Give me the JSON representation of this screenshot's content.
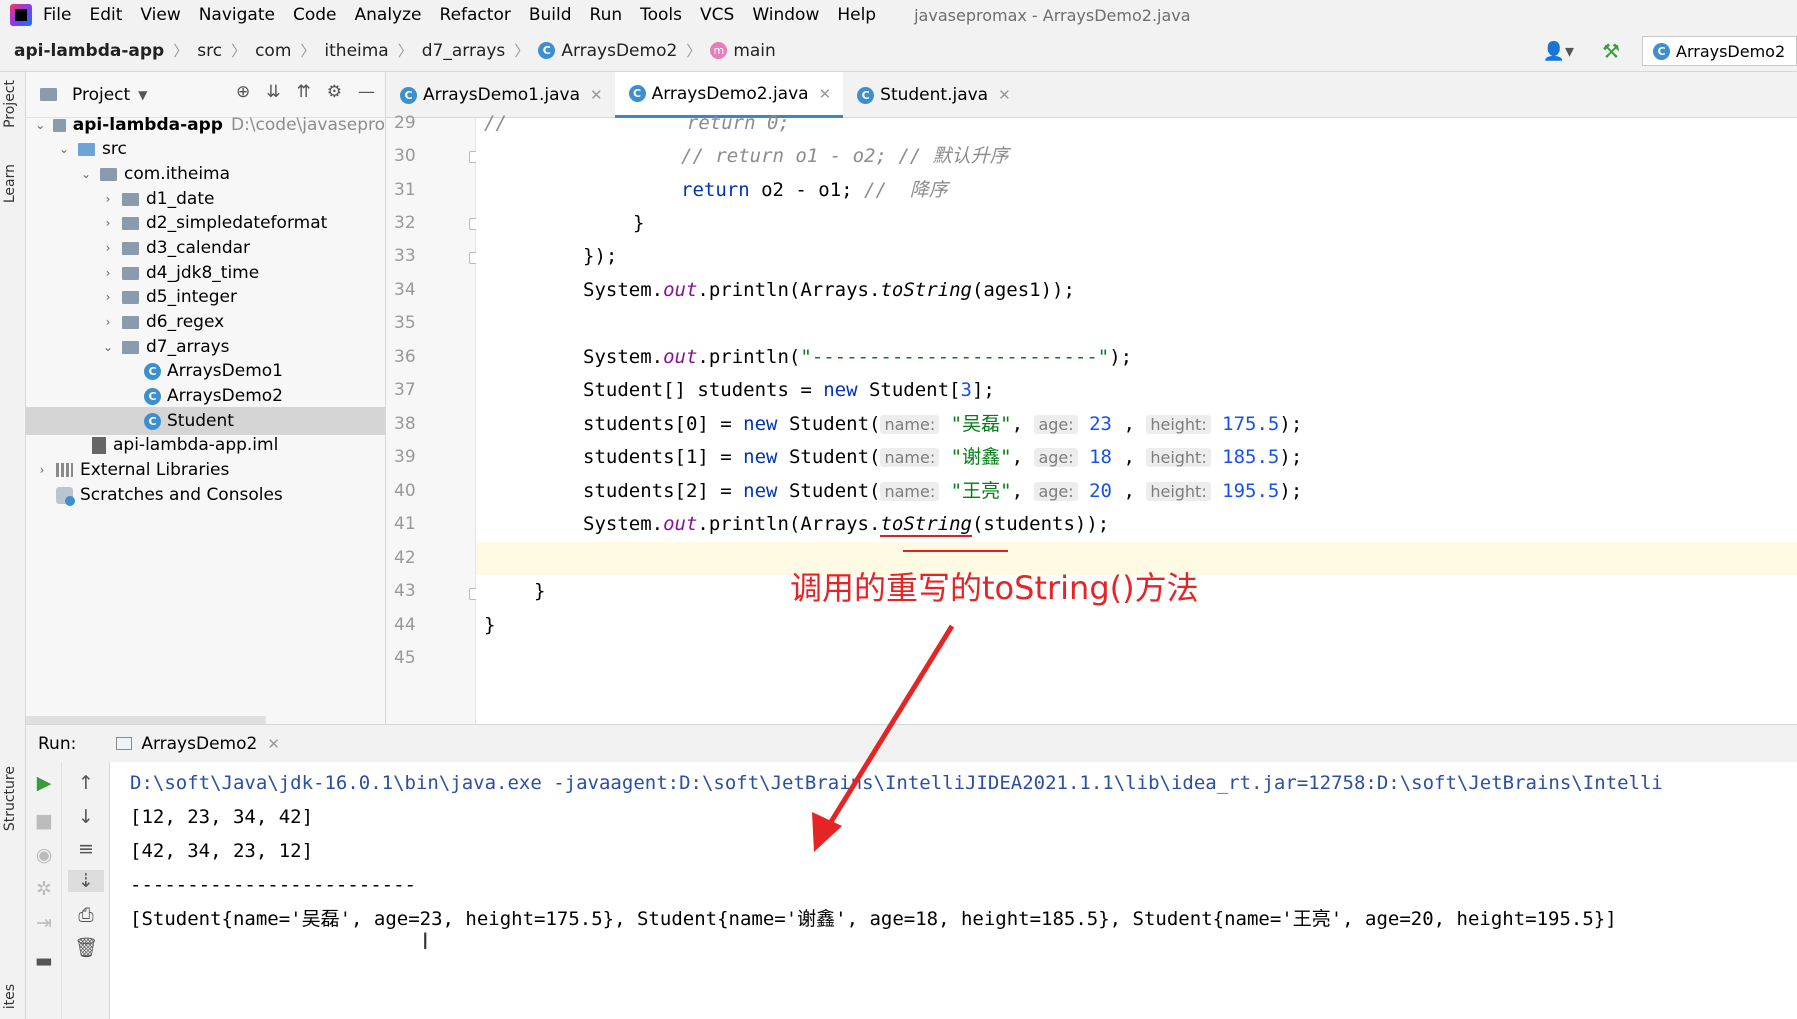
{
  "menubar": {
    "items": [
      "File",
      "Edit",
      "View",
      "Navigate",
      "Code",
      "Analyze",
      "Refactor",
      "Build",
      "Run",
      "Tools",
      "VCS",
      "Window",
      "Help"
    ],
    "window_title": "javasepromax - ArraysDemo2.java"
  },
  "navbar": {
    "breadcrumbs": [
      "api-lambda-app",
      "src",
      "com",
      "itheima",
      "d7_arrays",
      "ArraysDemo2",
      "main"
    ],
    "run_config": "ArraysDemo2"
  },
  "left_strip": {
    "project_tab": "Project",
    "learn_tab": "Learn",
    "structure_tab": "Structure",
    "bottom_tab": "ites"
  },
  "project_panel": {
    "title": "Project",
    "tree": [
      {
        "label": "api-lambda-app",
        "extra": "D:\\code\\javasepro"
      },
      {
        "label": "src"
      },
      {
        "label": "com.itheima"
      },
      {
        "label": "d1_date"
      },
      {
        "label": "d2_simpledateformat"
      },
      {
        "label": "d3_calendar"
      },
      {
        "label": "d4_jdk8_time"
      },
      {
        "label": "d5_integer"
      },
      {
        "label": "d6_regex"
      },
      {
        "label": "d7_arrays"
      },
      {
        "label": "ArraysDemo1"
      },
      {
        "label": "ArraysDemo2"
      },
      {
        "label": "Student"
      },
      {
        "label": "api-lambda-app.iml"
      },
      {
        "label": "External Libraries"
      },
      {
        "label": "Scratches and Consoles"
      }
    ]
  },
  "editor": {
    "tabs": [
      "ArraysDemo1.java",
      "ArraysDemo2.java",
      "Student.java"
    ],
    "line_numbers": [
      "29",
      "30",
      "31",
      "32",
      "33",
      "34",
      "35",
      "36",
      "37",
      "38",
      "39",
      "40",
      "41",
      "42",
      "43",
      "44",
      "45"
    ],
    "code": {
      "l29_a": "//",
      "l29_b": "return 0;",
      "l30": "// return o1 - o2; // 默认升序",
      "l31_kw": "return",
      "l31_expr": " o2 - o1; ",
      "l31_comment": "//  降序",
      "l32": "}",
      "l33": "});",
      "sys": "System.",
      "out": "out",
      "println_open": ".println(Arrays.",
      "toString": "toString",
      "l34_tail": "(ages1));",
      "l36_open": ".println(",
      "l36_str": "\"-------------------------\"",
      "l36_close": ");",
      "l37_a": "Student[] students = ",
      "l37_new": "new",
      "l37_b": " Student[",
      "l37_num": "3",
      "l37_c": "];",
      "students": [
        "students[0]",
        "students[1]",
        "students[2]"
      ],
      "new_kw": "new",
      "student_open": " Student(",
      "hint_name": "name:",
      "hint_age": "age:",
      "hint_height": "height:",
      "names": [
        "\"吴磊\"",
        "\"谢鑫\"",
        "\"王亮\""
      ],
      "ages": [
        "23",
        "18",
        "20"
      ],
      "heights": [
        "175.5",
        "185.5",
        "195.5"
      ],
      "l41_tail": "(students));",
      "l43": "}",
      "l44": "}"
    },
    "annotation": "调用的重写的toString()方法"
  },
  "run_panel": {
    "label": "Run:",
    "tab": "ArraysDemo2",
    "console": [
      "D:\\soft\\Java\\jdk-16.0.1\\bin\\java.exe -javaagent:D:\\soft\\JetBrains\\IntelliJIDEA2021.1.1\\lib\\idea_rt.jar=12758:D:\\soft\\JetBrains\\Intelli",
      "[12, 23, 34, 42]",
      "[42, 34, 23, 12]",
      "-------------------------",
      "[Student{name='吴磊', age=23, height=175.5}, Student{name='谢鑫', age=18, height=185.5}, Student{name='王亮', age=20, height=195.5}]"
    ],
    "cursor_glyph": "I"
  },
  "colors": {
    "accent": "#4083c9",
    "annotation": "#e52525",
    "keyword": "#0033b3",
    "string": "#067d17",
    "number": "#1750eb"
  }
}
